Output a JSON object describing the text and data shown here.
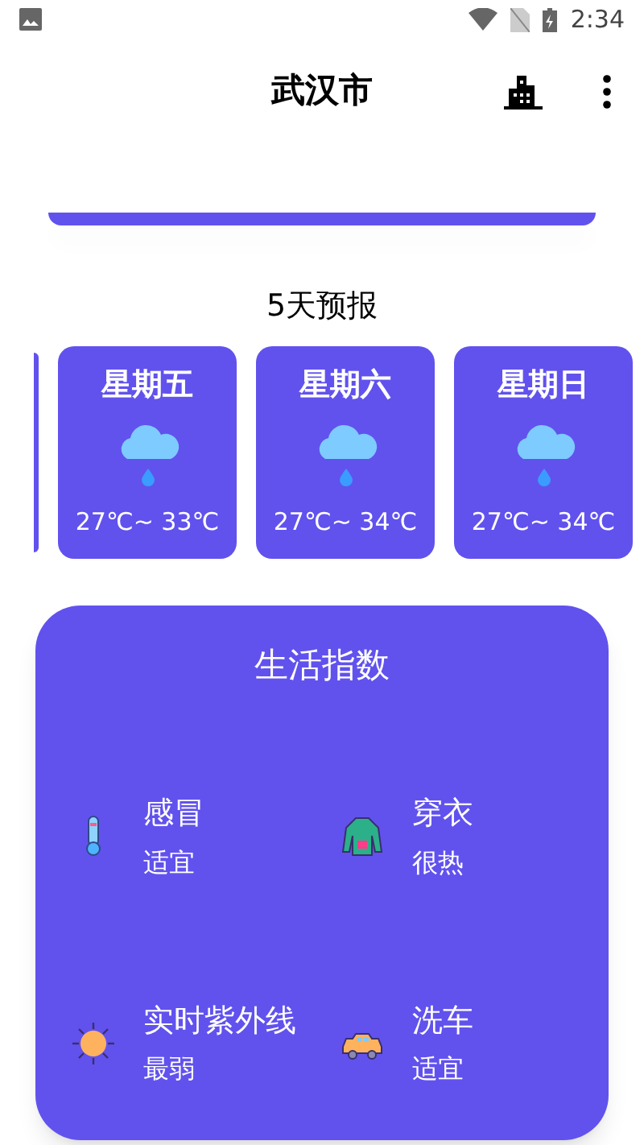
{
  "status_bar": {
    "time": "2:34"
  },
  "app_bar": {
    "title": "武汉市"
  },
  "forecast": {
    "title": "5天预报",
    "days": [
      {
        "day": "星期五",
        "range": "27℃~ 33℃"
      },
      {
        "day": "星期六",
        "range": "27℃~ 34℃"
      },
      {
        "day": "星期日",
        "range": "27℃~ 34℃"
      }
    ]
  },
  "life_index": {
    "title": "生活指数",
    "items": [
      {
        "kind": "thermometer",
        "name": "感冒",
        "value": "适宜"
      },
      {
        "kind": "coat",
        "name": "穿衣",
        "value": "很热"
      },
      {
        "kind": "sun",
        "name": "实时紫外线",
        "value": "最弱"
      },
      {
        "kind": "car",
        "name": "洗车",
        "value": "适宜"
      }
    ]
  }
}
